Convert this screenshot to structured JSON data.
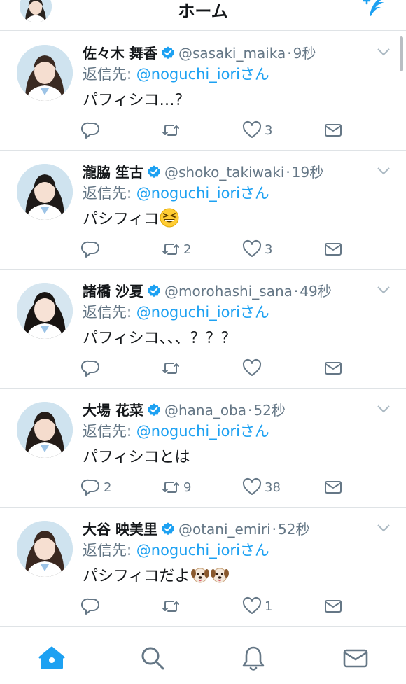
{
  "header": {
    "title": "ホーム"
  },
  "colors": {
    "accent": "#1da1f2",
    "muted": "#657786",
    "text": "#14171a",
    "divider": "#dfe3e6"
  },
  "tweets": [
    {
      "name": "佐々木 舞香",
      "handle": "@sasaki_maika",
      "dot": "·",
      "time": "9秒",
      "reply_prefix": "返信先: ",
      "reply_to": "@noguchi_ioriさん",
      "text": "パフィシコ…？",
      "emoji": [],
      "replies": "",
      "retweets": "",
      "likes": "3"
    },
    {
      "name": "瀧脇 笙古",
      "handle": "@shoko_takiwaki",
      "dot": "·",
      "time": "19秒",
      "reply_prefix": "返信先: ",
      "reply_to": "@noguchi_ioriさん",
      "text": "パシフィコ",
      "emoji": [
        "grinning-squint-emoji"
      ],
      "replies": "",
      "retweets": "2",
      "likes": "3"
    },
    {
      "name": "諸橋 沙夏",
      "handle": "@morohashi_sana",
      "dot": "·",
      "time": "49秒",
      "reply_prefix": "返信先: ",
      "reply_to": "@noguchi_ioriさん",
      "text": "パフィシコ、、、？？？",
      "emoji": [],
      "replies": "",
      "retweets": "",
      "likes": ""
    },
    {
      "name": "大場 花菜",
      "handle": "@hana_oba",
      "dot": "·",
      "time": "52秒",
      "reply_prefix": "返信先: ",
      "reply_to": "@noguchi_ioriさん",
      "text": "パフィシコとは",
      "emoji": [],
      "replies": "2",
      "retweets": "9",
      "likes": "38"
    },
    {
      "name": "大谷 映美里",
      "handle": "@otani_emiri",
      "dot": "·",
      "time": "52秒",
      "reply_prefix": "返信先: ",
      "reply_to": "@noguchi_ioriさん",
      "text": "パシフィコだよ",
      "emoji": [
        "dog-face-emoji",
        "dog-face-emoji"
      ],
      "replies": "",
      "retweets": "",
      "likes": "1"
    }
  ],
  "tabbar": {
    "items": [
      "home-icon",
      "search-icon",
      "notifications-icon",
      "messages-icon"
    ],
    "active": "home-icon"
  }
}
